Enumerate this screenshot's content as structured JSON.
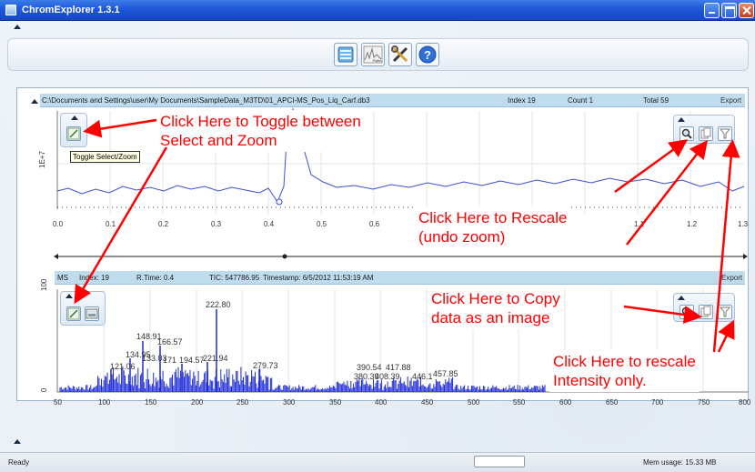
{
  "window": {
    "title": "ChromExplorer 1.3.1"
  },
  "toolbar": {
    "buttons": [
      "open-file-icon",
      "chart-icon",
      "tools-icon",
      "help-icon"
    ]
  },
  "chromatogram": {
    "path": "C:\\Documents and Settings\\user\\My Documents\\SampleData_M3TD\\01_APCI-MS_Pos_Liq_Carf.db3",
    "index": "Index 19",
    "count": "Count 1",
    "total": "Total 59",
    "export": "Export",
    "toggle_tooltip": "Toggle Select/Zoom",
    "y_tick": "1E+7",
    "x_ticks": [
      "0.0",
      "0.1",
      "0.2",
      "0.3",
      "0.4",
      "0.5",
      "0.6",
      "1.1",
      "1.2",
      "1.3"
    ]
  },
  "spectrum": {
    "type": "MS",
    "index": "Index: 19",
    "rtime": "R.Time: 0.4",
    "tic": "TIC: 547786.95",
    "timestamp": "Timestamp: 6/5/2012 11:53:19 AM",
    "export": "Export",
    "y_ticks": [
      "100",
      "0"
    ],
    "x_ticks": [
      "50",
      "100",
      "150",
      "200",
      "250",
      "300",
      "350",
      "400",
      "450",
      "500",
      "550",
      "600",
      "650",
      "700",
      "750",
      "800"
    ],
    "peak_labels": [
      "222.80",
      "148.91",
      "166.57",
      "134.95",
      "133.03",
      "171",
      "194.57",
      "221.94",
      "121.06",
      "279.73",
      "390.54",
      "417.88",
      "380.39",
      "408.39",
      "446.1",
      "457.85"
    ]
  },
  "annotations": {
    "toggle": [
      "Click Here to Toggle between",
      "Select and Zoom"
    ],
    "rescale": [
      "Click Here to Rescale",
      "(undo zoom)"
    ],
    "copy": [
      "Click Here to Copy",
      "data as an image"
    ],
    "intensity": [
      "Click Here to rescale",
      "Intensity only."
    ]
  },
  "status": {
    "ready": "Ready",
    "memory": "Mem usage: 15.33 MB"
  },
  "colors": {
    "titlebar": "#1d57d8",
    "trace": "#3a4fd6",
    "annotation": "#ff0000",
    "header_strip": "#bfdcee"
  }
}
